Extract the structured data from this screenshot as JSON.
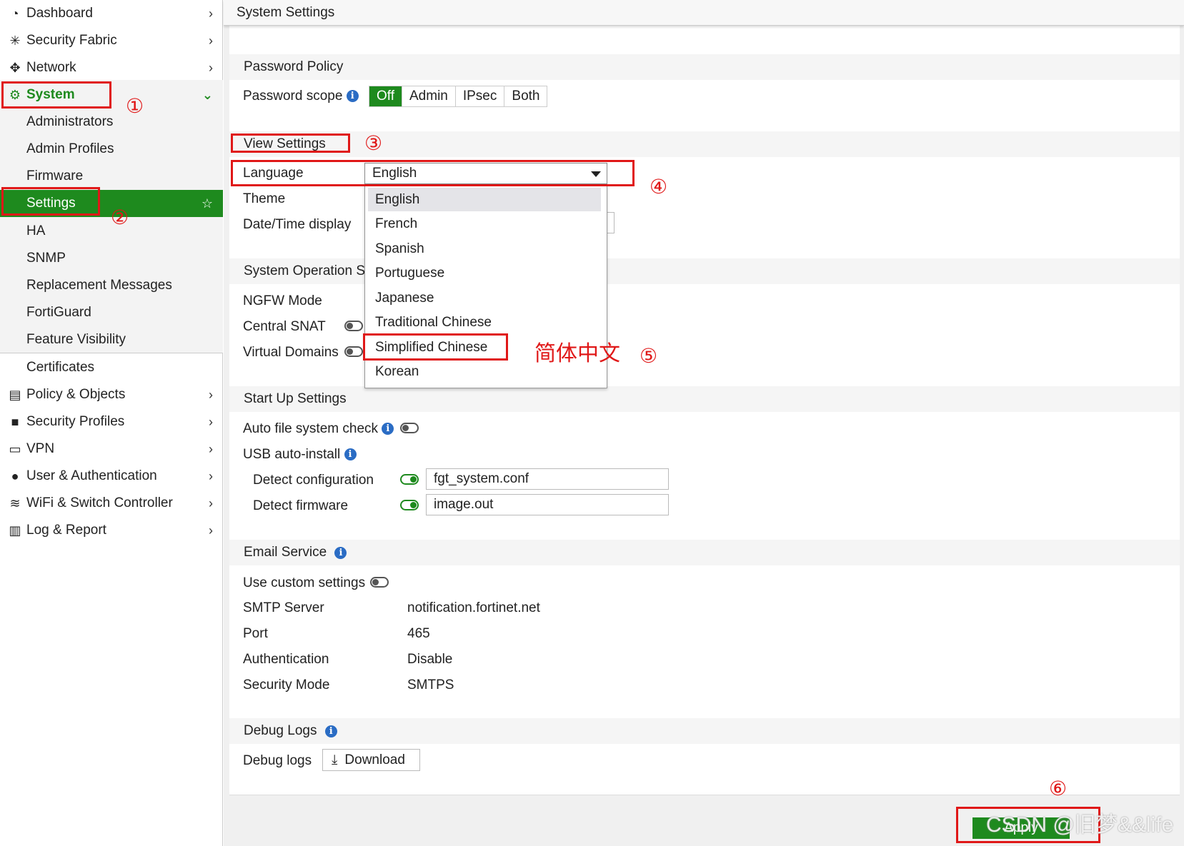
{
  "sidebar": {
    "items": [
      {
        "label": "Dashboard",
        "icon": "dashboard-icon"
      },
      {
        "label": "Security Fabric",
        "icon": "fabric-icon"
      },
      {
        "label": "Network",
        "icon": "network-icon"
      },
      {
        "label": "System",
        "icon": "gear-icon"
      },
      {
        "label": "Administrators"
      },
      {
        "label": "Admin Profiles"
      },
      {
        "label": "Firmware"
      },
      {
        "label": "Settings"
      },
      {
        "label": "HA"
      },
      {
        "label": "SNMP"
      },
      {
        "label": "Replacement Messages"
      },
      {
        "label": "FortiGuard"
      },
      {
        "label": "Feature Visibility"
      },
      {
        "label": "Certificates"
      },
      {
        "label": "Policy & Objects",
        "icon": "policy-icon"
      },
      {
        "label": "Security Profiles",
        "icon": "lock-icon"
      },
      {
        "label": "VPN",
        "icon": "laptop-icon"
      },
      {
        "label": "User & Authentication",
        "icon": "user-icon"
      },
      {
        "label": "WiFi & Switch Controller",
        "icon": "wifi-icon"
      },
      {
        "label": "Log & Report",
        "icon": "chart-icon"
      }
    ]
  },
  "header": {
    "title": "System Settings"
  },
  "password_policy": {
    "section": "Password Policy",
    "scope_label": "Password scope",
    "options": [
      "Off",
      "Admin",
      "IPsec",
      "Both"
    ],
    "selected": "Off"
  },
  "view_settings": {
    "section": "View Settings",
    "language_label": "Language",
    "language_value": "English",
    "theme_label": "Theme",
    "datetime_label": "Date/Time display",
    "language_options": [
      "English",
      "French",
      "Spanish",
      "Portuguese",
      "Japanese",
      "Traditional Chinese",
      "Simplified Chinese",
      "Korean"
    ]
  },
  "system_operation": {
    "section": "System Operation Se",
    "ngfw_label": "NGFW Mode",
    "snat_label": "Central SNAT",
    "vdom_label": "Virtual Domains"
  },
  "startup": {
    "section": "Start Up Settings",
    "auto_fs_label": "Auto file system check",
    "usb_label": "USB auto-install",
    "detect_config_label": "Detect configuration",
    "detect_config_value": "fgt_system.conf",
    "detect_fw_label": "Detect firmware",
    "detect_fw_value": "image.out"
  },
  "email": {
    "section": "Email Service",
    "custom_label": "Use custom settings",
    "smtp_label": "SMTP Server",
    "smtp_value": "notification.fortinet.net",
    "port_label": "Port",
    "port_value": "465",
    "auth_label": "Authentication",
    "auth_value": "Disable",
    "security_label": "Security Mode",
    "security_value": "SMTPS"
  },
  "debug": {
    "section": "Debug Logs",
    "label": "Debug logs",
    "download_label": "Download"
  },
  "footer": {
    "apply_label": "Apply"
  },
  "annotations": {
    "n1": "①",
    "n2": "②",
    "n3": "③",
    "n4": "④",
    "n5": "⑤",
    "n6": "⑥",
    "chinese_note": "简体中文",
    "watermark": "CSDN @旧梦&&life"
  },
  "colors": {
    "accent": "#1e8a1e",
    "annotation": "#e01818",
    "info": "#2a6cc4"
  }
}
